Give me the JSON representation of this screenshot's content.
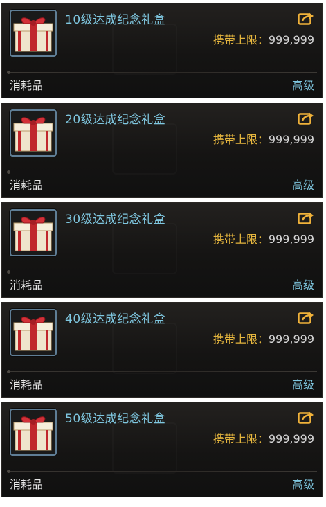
{
  "items": [
    {
      "name": "10级达成纪念礼盒",
      "carry_label": "携带上限：",
      "carry_value": "999,999",
      "type": "消耗品",
      "grade": "高级",
      "icon": "gift-box-icon"
    },
    {
      "name": "20级达成纪念礼盒",
      "carry_label": "携带上限：",
      "carry_value": "999,999",
      "type": "消耗品",
      "grade": "高级",
      "icon": "gift-box-icon"
    },
    {
      "name": "30级达成纪念礼盒",
      "carry_label": "携带上限：",
      "carry_value": "999,999",
      "type": "消耗品",
      "grade": "高级",
      "icon": "gift-box-icon"
    },
    {
      "name": "40级达成纪念礼盒",
      "carry_label": "携带上限：",
      "carry_value": "999,999",
      "type": "消耗品",
      "grade": "高级",
      "icon": "gift-box-icon"
    },
    {
      "name": "50级达成纪念礼盒",
      "carry_label": "携带上限：",
      "carry_value": "999,999",
      "type": "消耗品",
      "grade": "高级",
      "icon": "gift-box-icon"
    }
  ],
  "colors": {
    "item_name": "#7fc7e0",
    "carry_label": "#e5b63e",
    "grade": "#7fc7e0",
    "share_icon": "#f0b23a",
    "icon_frame": "#5f7e96"
  },
  "share_icon": "share-arrow-icon"
}
